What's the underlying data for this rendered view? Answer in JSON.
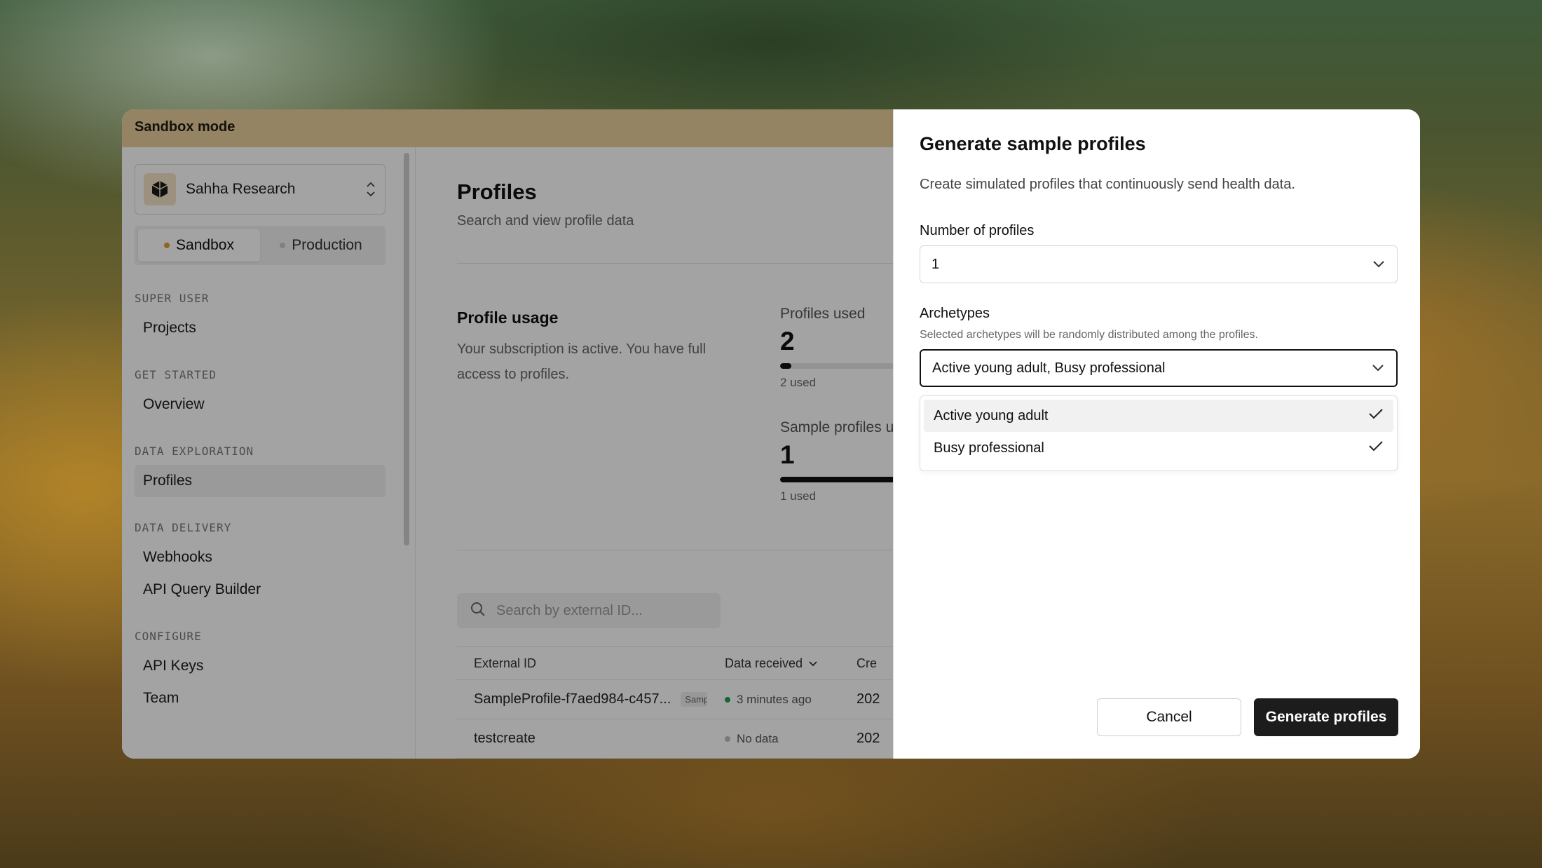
{
  "banner": {
    "text": "Sandbox mode"
  },
  "sidebar": {
    "org_name": "Sahha Research",
    "env": {
      "sandbox": "Sandbox",
      "production": "Production",
      "sandbox_dot_color": "#e0a02a",
      "production_dot_color": "#c8c8c8"
    },
    "sections": [
      {
        "label": "SUPER USER",
        "items": [
          "Projects"
        ]
      },
      {
        "label": "GET STARTED",
        "items": [
          "Overview"
        ]
      },
      {
        "label": "DATA EXPLORATION",
        "items": [
          "Profiles"
        ]
      },
      {
        "label": "DATA DELIVERY",
        "items": [
          "Webhooks",
          "API Query Builder"
        ]
      },
      {
        "label": "CONFIGURE",
        "items": [
          "API Keys",
          "Team"
        ]
      }
    ]
  },
  "main": {
    "title": "Profiles",
    "subtitle": "Search and view profile data",
    "usage": {
      "title": "Profile usage",
      "text": "Your subscription is active. You have full access to profiles.",
      "stats": [
        {
          "label": "Profiles used",
          "value": "2",
          "foot": "2 used",
          "fill": 0.03
        },
        {
          "label": "Sample profiles u",
          "value": "1",
          "foot": "1 used",
          "fill": 1.0
        }
      ]
    },
    "search_placeholder": "Search by external ID...",
    "table": {
      "headers": [
        "External ID",
        "Data received",
        "Cre"
      ],
      "rows": [
        {
          "id": "SampleProfile-f7aed984-c457...",
          "tag": "Samp",
          "status": "3 minutes ago",
          "status_color": "#1f9d55",
          "created": "202"
        },
        {
          "id": "testcreate",
          "tag": "",
          "status": "No data",
          "status_color": "#bdbdbd",
          "created": "202"
        }
      ]
    }
  },
  "modal": {
    "title": "Generate sample profiles",
    "description": "Create simulated profiles that continuously send health data.",
    "number_label": "Number of profiles",
    "number_value": "1",
    "archetypes_label": "Archetypes",
    "archetypes_hint": "Selected archetypes will be randomly distributed among the profiles.",
    "archetypes_value": "Active young adult, Busy professional",
    "options": [
      "Active young adult",
      "Busy professional"
    ],
    "cancel": "Cancel",
    "submit": "Generate profiles"
  }
}
